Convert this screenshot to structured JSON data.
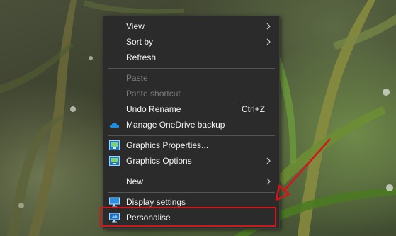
{
  "context_menu": {
    "items": [
      {
        "label": "View",
        "has_submenu": true
      },
      {
        "label": "Sort by",
        "has_submenu": true
      },
      {
        "label": "Refresh"
      },
      {
        "label": "Paste",
        "disabled": true
      },
      {
        "label": "Paste shortcut",
        "disabled": true
      },
      {
        "label": "Undo Rename",
        "shortcut": "Ctrl+Z"
      },
      {
        "label": "Manage OneDrive backup",
        "icon": "onedrive-cloud-icon"
      },
      {
        "label": "Graphics Properties...",
        "icon": "intel-graphics-icon"
      },
      {
        "label": "Graphics Options",
        "icon": "intel-graphics-icon",
        "has_submenu": true
      },
      {
        "label": "New",
        "has_submenu": true
      },
      {
        "label": "Display settings",
        "icon": "display-monitor-icon"
      },
      {
        "label": "Personalise",
        "icon": "personalise-monitor-icon",
        "highlighted": true
      }
    ]
  },
  "annotation": {
    "highlight_color": "#d8141b",
    "arrow_color": "#d8141b"
  }
}
